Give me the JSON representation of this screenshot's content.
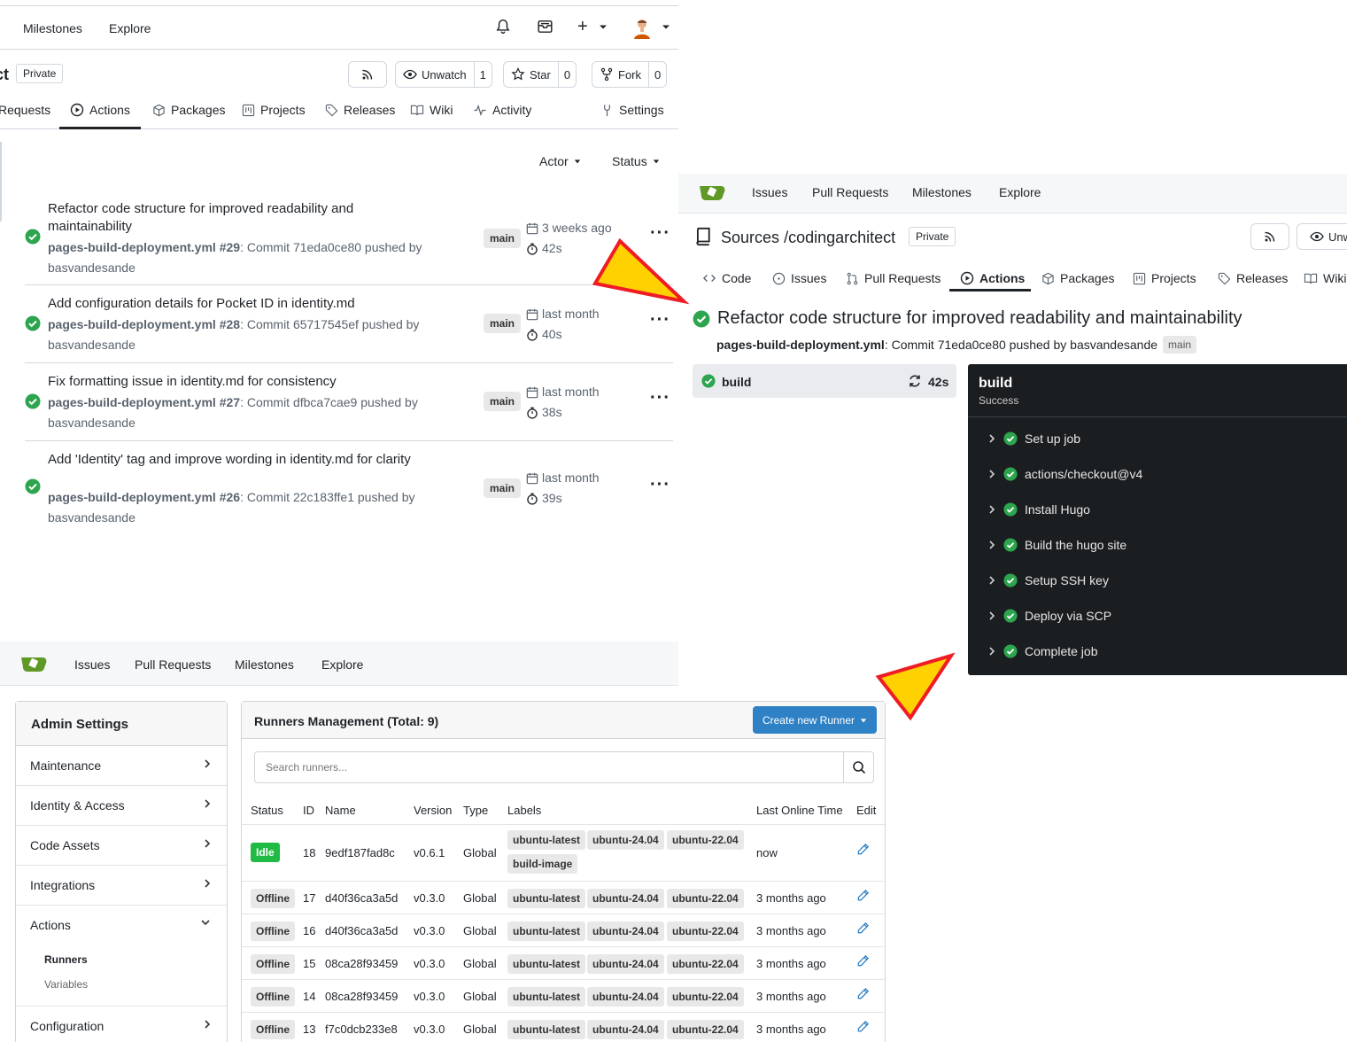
{
  "colors": {
    "success": "#2da44e",
    "arrow_fill": "#ffd100",
    "arrow_stroke": "#ee1c25",
    "create_button": "#2f81c5",
    "idle_badge": "#21ba45",
    "log_bg": "#1b1e21"
  },
  "runs_view": {
    "top_nav": [
      "Milestones",
      "Explore"
    ],
    "repo_name_fragment": "ct",
    "private_label": "Private",
    "rss_icon": "rss-icon",
    "watch_label": "Unwatch",
    "watch_count": "1",
    "star_label": "Star",
    "star_count": "0",
    "fork_label": "Fork",
    "fork_count": "0",
    "tabs": [
      {
        "label": "Requests",
        "icon": ""
      },
      {
        "label": "Actions",
        "icon": "play-circle-icon"
      },
      {
        "label": "Packages",
        "icon": "package-icon"
      },
      {
        "label": "Projects",
        "icon": "project-icon"
      },
      {
        "label": "Releases",
        "icon": "tag-icon"
      },
      {
        "label": "Wiki",
        "icon": "book-icon"
      },
      {
        "label": "Activity",
        "icon": "pulse-icon"
      },
      {
        "label": "Settings",
        "icon": "tool-icon"
      }
    ],
    "filters": [
      "Actor",
      "Status"
    ],
    "runs": [
      {
        "title": "Refactor code structure for improved readability and maintainability",
        "workflow": "pages-build-deployment.yml #29",
        "commit_text": ": Commit 71eda0ce80 pushed by",
        "author": "basvandesande",
        "branch": "main",
        "when": "3 weeks ago",
        "duration": "42s"
      },
      {
        "title": "Add configuration details for Pocket ID in identity.md",
        "workflow": "pages-build-deployment.yml #28",
        "commit_text": ": Commit 65717545ef pushed by",
        "author": "basvandesande",
        "branch": "main",
        "when": "last month",
        "duration": "40s"
      },
      {
        "title": "Fix formatting issue in identity.md for consistency",
        "workflow": "pages-build-deployment.yml #27",
        "commit_text": ": Commit dfbca7cae9 pushed by",
        "author": "basvandesande",
        "branch": "main",
        "when": "last month",
        "duration": "38s"
      },
      {
        "title": "Add 'Identity' tag and improve wording in identity.md for clarity",
        "workflow": "pages-build-deployment.yml #26",
        "commit_text": ": Commit 22c183ffe1 pushed by",
        "author": "basvandesande",
        "branch": "main",
        "when": "last month",
        "duration": "39s"
      }
    ]
  },
  "run_detail": {
    "top_nav": [
      "Issues",
      "Pull Requests",
      "Milestones",
      "Explore"
    ],
    "owner": "Sources",
    "separator": "/",
    "repo": "codingarchitect",
    "private_label": "Private",
    "watch_label": "Unw",
    "tabs": [
      {
        "label": "Code",
        "icon": "code-icon"
      },
      {
        "label": "Issues",
        "icon": "issue-icon"
      },
      {
        "label": "Pull Requests",
        "icon": "pull-request-icon"
      },
      {
        "label": "Actions",
        "icon": "play-circle-icon"
      },
      {
        "label": "Packages",
        "icon": "package-icon"
      },
      {
        "label": "Projects",
        "icon": "project-icon"
      },
      {
        "label": "Releases",
        "icon": "tag-icon"
      },
      {
        "label": "Wiki",
        "icon": "book-icon"
      }
    ],
    "run_title": "Refactor code structure for improved readability and maintainability",
    "workflow_file": "pages-build-deployment.yml",
    "commit_text": ": Commit 71eda0ce80 pushed by basvandesande",
    "branch": "main",
    "job_name": "build",
    "job_duration": "42s",
    "log_title": "build",
    "log_status": "Success",
    "steps": [
      "Set up job",
      "actions/checkout@v4",
      "Install Hugo",
      "Build the hugo site",
      "Setup SSH key",
      "Deploy via SCP",
      "Complete job"
    ]
  },
  "admin": {
    "top_nav": [
      "Issues",
      "Pull Requests",
      "Milestones",
      "Explore"
    ],
    "sidebar_title": "Admin Settings",
    "sidebar_items": [
      "Maintenance",
      "Identity & Access",
      "Code Assets",
      "Integrations",
      "Actions",
      "Configuration"
    ],
    "actions_sub": [
      "Runners",
      "Variables"
    ],
    "title": "Runners Management (Total: 9)",
    "create_label": "Create new Runner",
    "search_placeholder": "Search runners...",
    "columns": [
      "Status",
      "ID",
      "Name",
      "Version",
      "Type",
      "Labels",
      "Last Online Time",
      "Edit"
    ],
    "rows": [
      {
        "status": "Idle",
        "id": "18",
        "name": "9edf187fad8c",
        "version": "v0.6.1",
        "type": "Global",
        "labels": [
          "ubuntu-latest",
          "ubuntu-24.04",
          "ubuntu-22.04",
          "build-image"
        ],
        "last_online": "now"
      },
      {
        "status": "Offline",
        "id": "17",
        "name": "d40f36ca3a5d",
        "version": "v0.3.0",
        "type": "Global",
        "labels": [
          "ubuntu-latest",
          "ubuntu-24.04",
          "ubuntu-22.04"
        ],
        "last_online": "3 months ago"
      },
      {
        "status": "Offline",
        "id": "16",
        "name": "d40f36ca3a5d",
        "version": "v0.3.0",
        "type": "Global",
        "labels": [
          "ubuntu-latest",
          "ubuntu-24.04",
          "ubuntu-22.04"
        ],
        "last_online": "3 months ago"
      },
      {
        "status": "Offline",
        "id": "15",
        "name": "08ca28f93459",
        "version": "v0.3.0",
        "type": "Global",
        "labels": [
          "ubuntu-latest",
          "ubuntu-24.04",
          "ubuntu-22.04"
        ],
        "last_online": "3 months ago"
      },
      {
        "status": "Offline",
        "id": "14",
        "name": "08ca28f93459",
        "version": "v0.3.0",
        "type": "Global",
        "labels": [
          "ubuntu-latest",
          "ubuntu-24.04",
          "ubuntu-22.04"
        ],
        "last_online": "3 months ago"
      },
      {
        "status": "Offline",
        "id": "13",
        "name": "f7c0dcb233e8",
        "version": "v0.3.0",
        "type": "Global",
        "labels": [
          "ubuntu-latest",
          "ubuntu-24.04",
          "ubuntu-22.04"
        ],
        "last_online": "3 months ago"
      }
    ]
  }
}
